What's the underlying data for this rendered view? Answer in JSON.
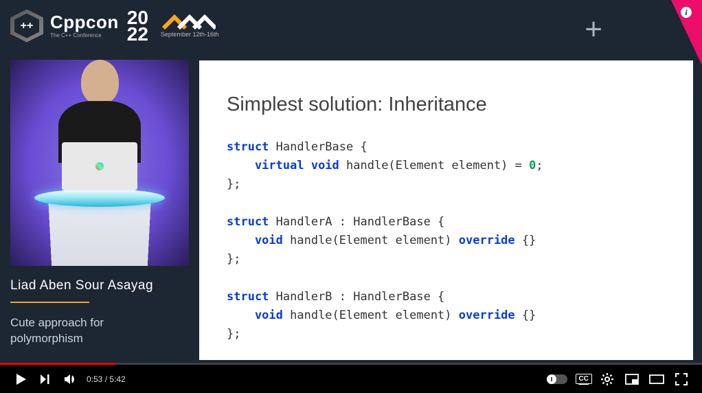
{
  "header": {
    "conf_name": "Cppcon",
    "conf_sub": "The C++ Conference",
    "year_top": "20",
    "year_bottom": "22",
    "date_range": "September 12th-16th"
  },
  "speaker": {
    "name": "Liad Aben Sour Asayag",
    "talk_line1": "Cute approach for",
    "talk_line2": "polymorphism"
  },
  "slide": {
    "title": "Simplest solution: Inheritance"
  },
  "code": {
    "l1a": "struct",
    "l1b": " HandlerBase {",
    "l2a": "    virtual",
    "l2b": " void",
    "l2c": " handle(Element element) = ",
    "l2d": "0",
    "l2e": ";",
    "l3": "};",
    "l4a": "struct",
    "l4b": " HandlerA : HandlerBase {",
    "l5a": "    void",
    "l5b": " handle(Element element) ",
    "l5c": "override",
    "l5d": " {}",
    "l6": "};",
    "l7a": "struct",
    "l7b": " HandlerB : HandlerBase {",
    "l8a": "    void",
    "l8b": " handle(Element element) ",
    "l8c": "override",
    "l8d": " {}",
    "l9": "};"
  },
  "player": {
    "current_time": "0:53",
    "duration": "5:42",
    "cc_label": "CC"
  }
}
